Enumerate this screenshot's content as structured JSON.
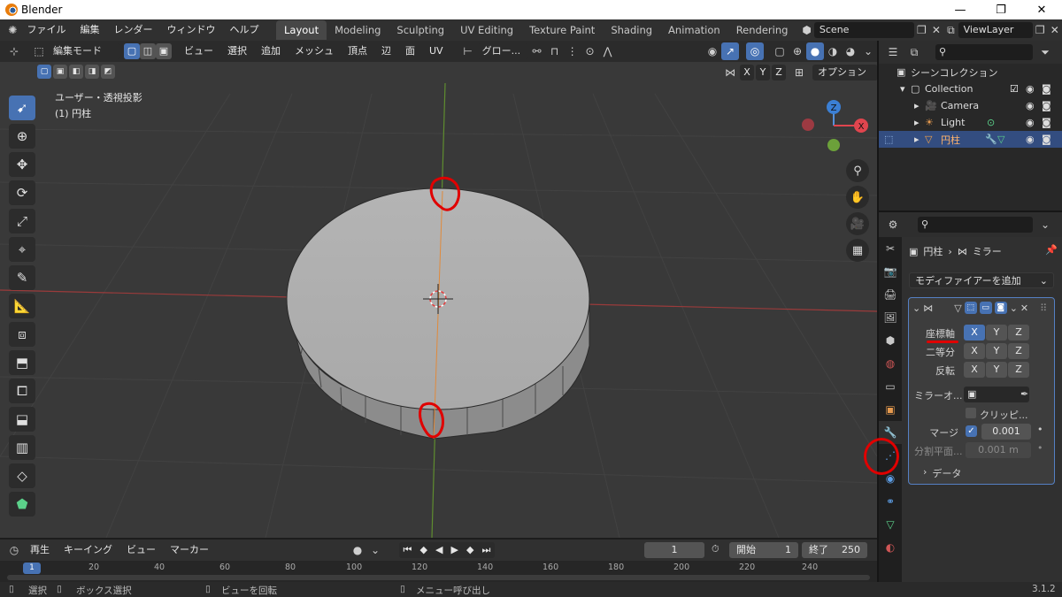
{
  "window": {
    "app_title": "Blender",
    "minimize": "—",
    "maximize": "❐",
    "close": "✕"
  },
  "topbar": {
    "menus": [
      "ファイル",
      "編集",
      "レンダー",
      "ウィンドウ",
      "ヘルプ"
    ],
    "workspaces": [
      "Layout",
      "Modeling",
      "Sculpting",
      "UV Editing",
      "Texture Paint",
      "Shading",
      "Animation",
      "Rendering"
    ],
    "active_workspace": "Layout",
    "scene": "Scene",
    "view_layer": "ViewLayer"
  },
  "viewport": {
    "mode": "編集モード",
    "menus": [
      "ビュー",
      "選択",
      "追加",
      "メッシュ",
      "頂点",
      "辺",
      "面",
      "UV"
    ],
    "transform_orientation": "グロー...",
    "options_label": "オプション",
    "mirror_axes": [
      "X",
      "Y",
      "Z"
    ],
    "view_name": "ユーザー・透視投影",
    "object_info": "(1) 円柱",
    "gizmo_labels": {
      "z": "Z",
      "x": "X"
    },
    "accent_color": "#4772b3"
  },
  "outliner": {
    "search_placeholder": "",
    "rows": [
      {
        "label": "シーンコレクション"
      },
      {
        "label": "Collection"
      },
      {
        "label": "Camera"
      },
      {
        "label": "Light"
      },
      {
        "label": "円柱"
      }
    ]
  },
  "properties": {
    "breadcrumb_object": "円柱",
    "breadcrumb_modifier": "ミラー",
    "add_modifier": "モディファイアーを追加",
    "rows": {
      "axis": {
        "label": "座標軸",
        "buttons": [
          "X",
          "Y",
          "Z"
        ]
      },
      "bisect": {
        "label": "二等分",
        "buttons": [
          "X",
          "Y",
          "Z"
        ]
      },
      "flip": {
        "label": "反転",
        "buttons": [
          "X",
          "Y",
          "Z"
        ]
      }
    },
    "mirror_object_label": "ミラーオ...",
    "clipping_label": "クリッピ...",
    "merge_label": "マージ",
    "merge_value": "0.001",
    "bisect_distance_label": "分割平面...",
    "bisect_distance_value": "0.001 m",
    "data_section": "データ"
  },
  "timeline": {
    "menus": [
      "再生",
      "キーイング",
      "ビュー",
      "マーカー"
    ],
    "current_frame": "1",
    "start_label": "開始",
    "start": "1",
    "end_label": "終了",
    "end": "250",
    "ruler": [
      "1",
      "20",
      "40",
      "60",
      "80",
      "100",
      "120",
      "140",
      "160",
      "180",
      "200",
      "220",
      "240"
    ]
  },
  "statusbar": {
    "select": "選択",
    "box_select": "ボックス選択",
    "rotate_view": "ビューを回転",
    "call_menu": "メニュー呼び出し",
    "version": "3.1.2"
  }
}
